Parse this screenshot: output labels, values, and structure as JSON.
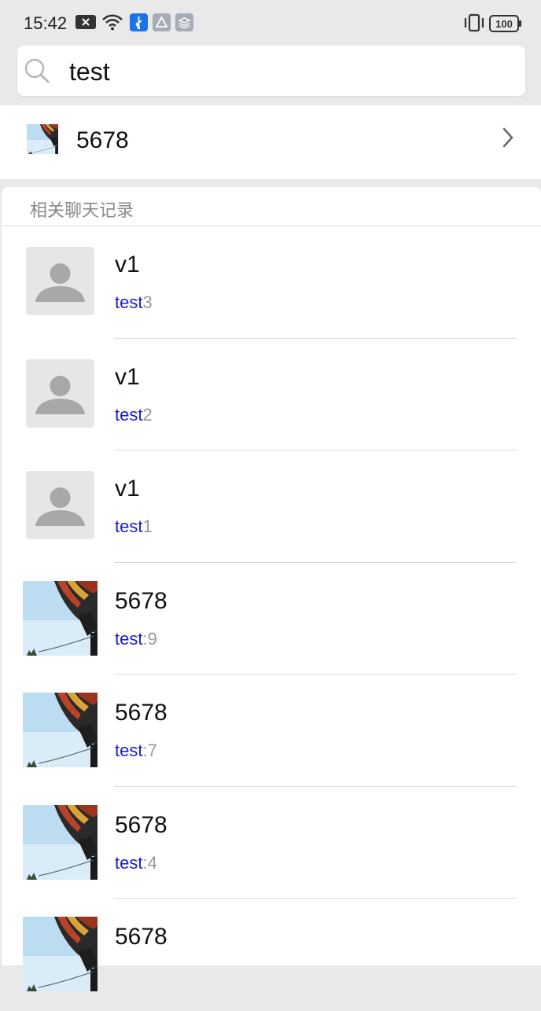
{
  "status_bar": {
    "time": "15:42",
    "battery": "100",
    "icons": [
      "notification-x-icon",
      "wifi-icon",
      "usb-icon",
      "app-icon",
      "layers-icon",
      "vibrate-icon",
      "battery-icon"
    ]
  },
  "search": {
    "query": "test",
    "icon": "search-icon"
  },
  "contact_result": {
    "name": "5678",
    "avatar": "balloon-photo"
  },
  "records_section": {
    "title": "相关聊天记录"
  },
  "records": [
    {
      "name": "v1",
      "highlight": "test",
      "rest": "3",
      "avatar": "default"
    },
    {
      "name": "v1",
      "highlight": "test",
      "rest": "2",
      "avatar": "default"
    },
    {
      "name": "v1",
      "highlight": "test",
      "rest": "1",
      "avatar": "default"
    },
    {
      "name": "5678",
      "highlight": "test",
      "rest": ":9",
      "avatar": "balloon-photo"
    },
    {
      "name": "5678",
      "highlight": "test",
      "rest": ":7",
      "avatar": "balloon-photo"
    },
    {
      "name": "5678",
      "highlight": "test",
      "rest": ":4",
      "avatar": "balloon-photo"
    },
    {
      "name": "5678",
      "highlight": "",
      "rest": "",
      "avatar": "balloon-photo"
    }
  ],
  "colors": {
    "background": "#e9e9e9",
    "highlight": "#1a1ad6",
    "secondary_text": "#999999"
  }
}
